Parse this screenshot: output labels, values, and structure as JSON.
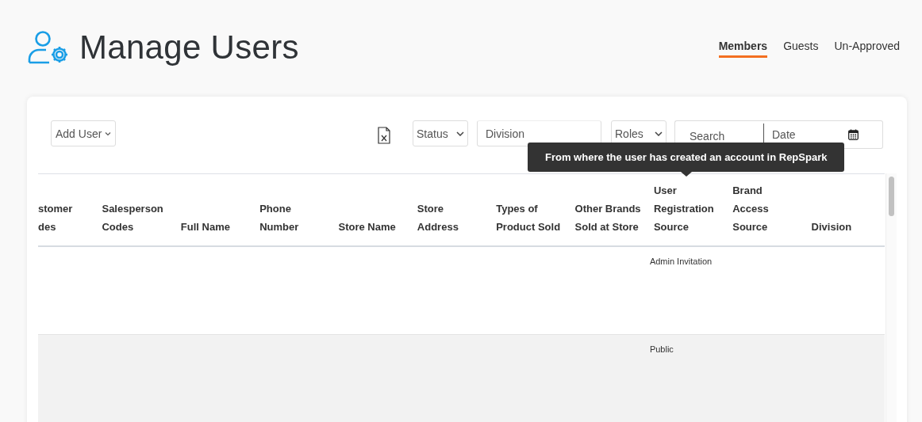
{
  "page": {
    "title": "Manage Users"
  },
  "tabs": [
    {
      "label": "Members",
      "selected": true
    },
    {
      "label": "Guests",
      "selected": false
    },
    {
      "label": "Un-Approved",
      "selected": false
    }
  ],
  "toolbar": {
    "add_user": "Add User",
    "status": "Status",
    "division": {
      "placeholder": "Division"
    },
    "roles": "Roles",
    "search": {
      "placeholder": "Search"
    },
    "date": {
      "placeholder": "Date"
    }
  },
  "tooltip": "From where the user has created an account in RepSpark",
  "table": {
    "columns": [
      {
        "lines": [
          "stomer",
          "des"
        ]
      },
      {
        "lines": [
          "Salesperson",
          "Codes"
        ]
      },
      {
        "lines": [
          "Full Name"
        ]
      },
      {
        "lines": [
          "Phone",
          "Number"
        ]
      },
      {
        "lines": [
          "Store Name"
        ]
      },
      {
        "lines": [
          "Store",
          "Address"
        ]
      },
      {
        "lines": [
          "Types of",
          "Product Sold"
        ]
      },
      {
        "lines": [
          "Other Brands",
          "Sold at Store"
        ]
      },
      {
        "lines": [
          "User",
          "Registration",
          "Source"
        ]
      },
      {
        "lines": [
          "Brand",
          "Access",
          "Source"
        ]
      },
      {
        "lines": [
          "Division"
        ]
      }
    ],
    "rows": [
      {
        "user_registration_source": "Admin Invitation"
      },
      {
        "user_registration_source": "Public"
      }
    ]
  }
}
